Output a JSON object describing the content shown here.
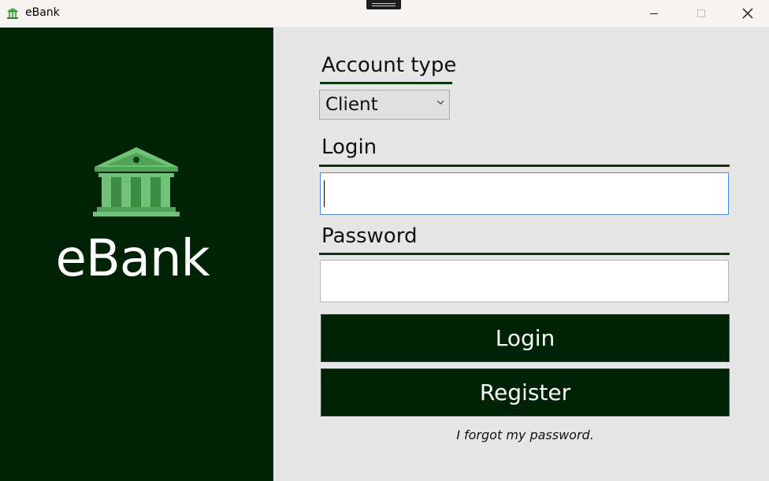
{
  "window": {
    "title": "eBank",
    "icon": "bank-icon",
    "controls": {
      "minimize": "minimize-icon",
      "maximize": "maximize-icon",
      "close": "close-icon"
    }
  },
  "brand": {
    "name": "eBank",
    "logo_icon": "bank-building-icon"
  },
  "form": {
    "account_type": {
      "label": "Account type",
      "selected": "Client"
    },
    "login": {
      "label": "Login",
      "value": ""
    },
    "password": {
      "label": "Password",
      "value": ""
    },
    "buttons": {
      "login": "Login",
      "register": "Register"
    },
    "forgot_link": "I forgot my password."
  },
  "colors": {
    "brand_dark": "#002205",
    "accent_green": "#66bb6a",
    "form_background": "#e6e6e6"
  }
}
